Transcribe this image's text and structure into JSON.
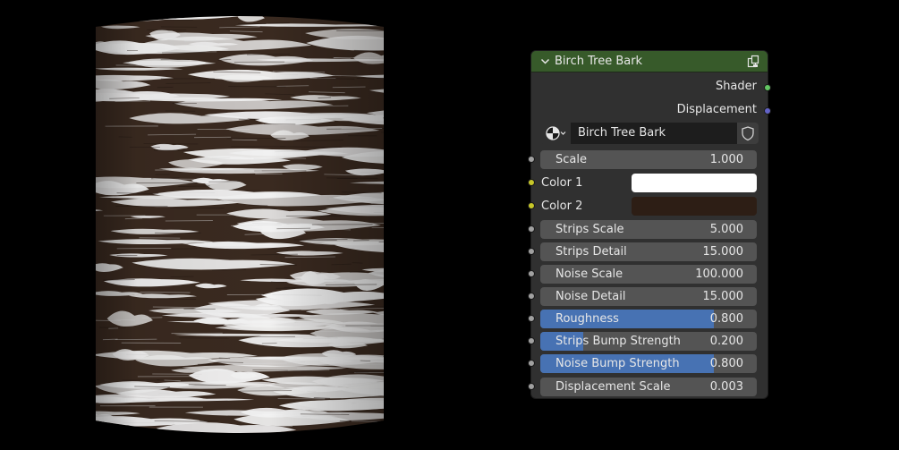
{
  "node": {
    "title": "Birch Tree Bark",
    "header_color": "#375a2a",
    "collapse_icon": "chevron-down-icon",
    "group_icon": "node-group-icon",
    "outputs": [
      {
        "label": "Shader",
        "socket_color": "#63c763"
      },
      {
        "label": "Displacement",
        "socket_color": "#6363c7"
      }
    ],
    "datablock": {
      "type_icon": "material-sphere-icon",
      "name": "Birch Tree Bark",
      "fake_user_icon": "shield-icon"
    },
    "inputs": [
      {
        "id": "scale",
        "label": "Scale",
        "value": "1.000",
        "factor": null
      },
      {
        "id": "color1",
        "label": "Color 1",
        "color": "#ffffff"
      },
      {
        "id": "color2",
        "label": "Color 2",
        "color": "#2d1e15"
      },
      {
        "id": "strips-scale",
        "label": "Strips Scale",
        "value": "5.000",
        "factor": null
      },
      {
        "id": "strips-detail",
        "label": "Strips Detail",
        "value": "15.000",
        "factor": null
      },
      {
        "id": "noise-scale",
        "label": "Noise Scale",
        "value": "100.000",
        "factor": null
      },
      {
        "id": "noise-detail",
        "label": "Noise Detail",
        "value": "15.000",
        "factor": null
      },
      {
        "id": "roughness",
        "label": "Roughness",
        "value": "0.800",
        "factor": 0.8
      },
      {
        "id": "strips-bump",
        "label": "Strips Bump Strength",
        "value": "0.200",
        "factor": 0.2
      },
      {
        "id": "noise-bump",
        "label": "Noise Bump Strength",
        "value": "0.800",
        "factor": 0.8
      },
      {
        "id": "displacement-scale",
        "label": "Displacement Scale",
        "value": "0.003",
        "factor": null
      }
    ],
    "socket_colors": {
      "float": "#a1a1a1",
      "color": "#c7c729"
    },
    "accent": "#4772b3"
  },
  "preview": {
    "bark_dark": "#3a2a20",
    "bark_light": "#f2f2f2"
  }
}
